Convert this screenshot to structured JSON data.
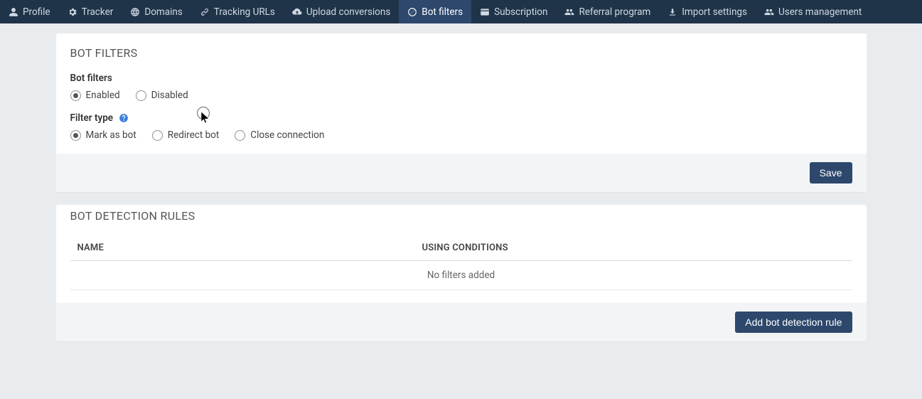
{
  "nav": {
    "items": [
      {
        "label": "Profile"
      },
      {
        "label": "Tracker"
      },
      {
        "label": "Domains"
      },
      {
        "label": "Tracking URLs"
      },
      {
        "label": "Upload conversions"
      },
      {
        "label": "Bot filters"
      },
      {
        "label": "Subscription"
      },
      {
        "label": "Referral program"
      },
      {
        "label": "Import settings"
      },
      {
        "label": "Users management"
      }
    ],
    "active_index": 5
  },
  "filters_panel": {
    "title": "BOT FILTERS",
    "bot_filters_label": "Bot filters",
    "enabled_label": "Enabled",
    "disabled_label": "Disabled",
    "filter_type_label": "Filter type",
    "mark_label": "Mark as bot",
    "redirect_label": "Redirect bot",
    "close_label": "Close connection",
    "save_label": "Save"
  },
  "rules_panel": {
    "title": "BOT DETECTION RULES",
    "col_name": "NAME",
    "col_cond": "USING CONDITIONS",
    "empty": "No filters added",
    "add_label": "Add bot detection rule"
  }
}
